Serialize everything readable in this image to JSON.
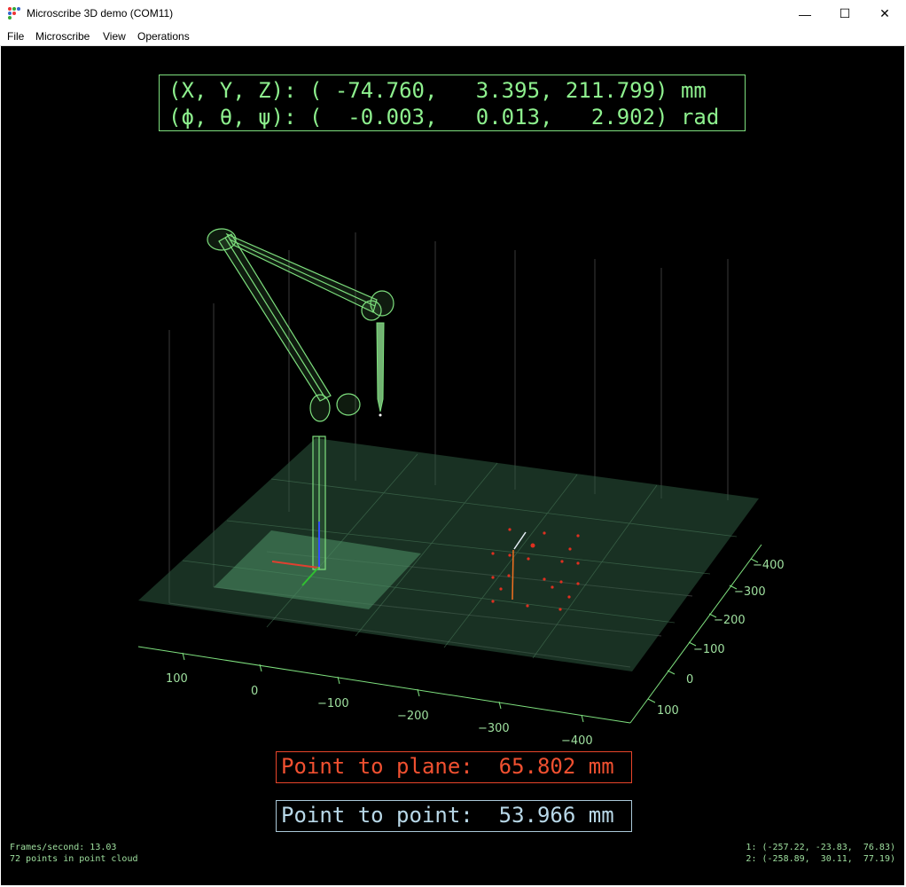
{
  "window": {
    "title": "Microscribe 3D demo (COM11)",
    "minimize_glyph": "—",
    "maximize_glyph": "☐",
    "close_glyph": "✕"
  },
  "menu": [
    "File",
    "Microscribe",
    "View",
    "Operations"
  ],
  "readout": {
    "position_line": "(X, Y, Z): ( -74.760,   3.395, 211.799) mm",
    "orientation_line": "(ϕ, θ, ψ): (  -0.003,   0.013,   2.902) rad"
  },
  "point_to_plane": "Point to plane:  65.802 mm",
  "point_to_point": "Point to point:  53.966 mm",
  "status": {
    "fps": "Frames/second: 13.03",
    "points": "72 points in point cloud",
    "p1": "1: (-257.22, -23.83,  76.83)",
    "p2": "2: (-258.89,  30.11,  77.19)"
  },
  "axes": {
    "x_ticks": [
      "100",
      "0",
      "−100",
      "−200",
      "−300",
      "−400"
    ],
    "y_ticks": [
      "−400",
      "−300",
      "−200",
      "−100",
      "0",
      "100"
    ]
  },
  "colors": {
    "readout": "#8ef08e",
    "plane": "#f05030",
    "point": "#b8d8e8",
    "arm": "#7ee07e",
    "cloud": "#e03020"
  },
  "icons": [
    "app-icon",
    "minimize-icon",
    "maximize-icon",
    "close-icon"
  ]
}
